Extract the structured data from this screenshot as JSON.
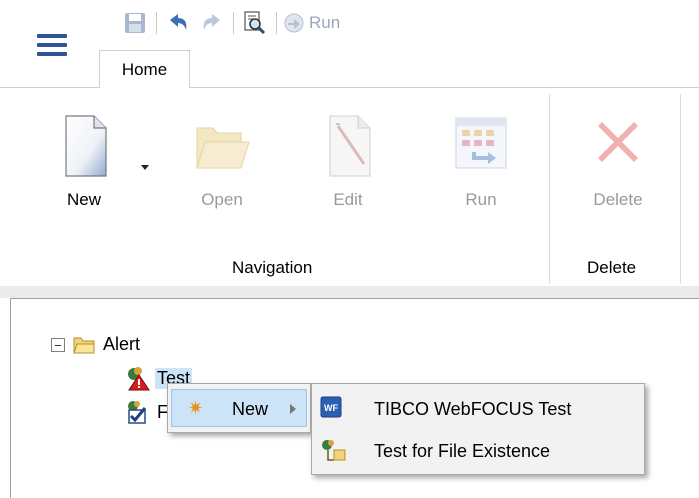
{
  "toolbar": {
    "run_label": "Run"
  },
  "tabs": [
    {
      "label": "Home"
    }
  ],
  "ribbon": {
    "navigation": {
      "group_label": "Navigation",
      "buttons": [
        {
          "label": "New"
        },
        {
          "label": "Open"
        },
        {
          "label": "Edit"
        },
        {
          "label": "Run"
        }
      ]
    },
    "delete": {
      "group_label": "Delete",
      "buttons": [
        {
          "label": "Delete"
        }
      ]
    }
  },
  "tree": {
    "root": {
      "label": "Alert",
      "expanded": true
    },
    "children": [
      {
        "label": "Test",
        "selected": true
      },
      {
        "label": "F"
      }
    ]
  },
  "context_menu": {
    "items": [
      {
        "label": "New",
        "has_submenu": true
      }
    ]
  },
  "submenu": {
    "items": [
      {
        "label": "TIBCO WebFOCUS Test"
      },
      {
        "label": "Test for File Existence"
      }
    ]
  },
  "colors": {
    "accent": "#2f5597",
    "selection": "#cde3f7",
    "disabled_text": "#9a9a9a",
    "delete_red": "#e8a3a3"
  }
}
